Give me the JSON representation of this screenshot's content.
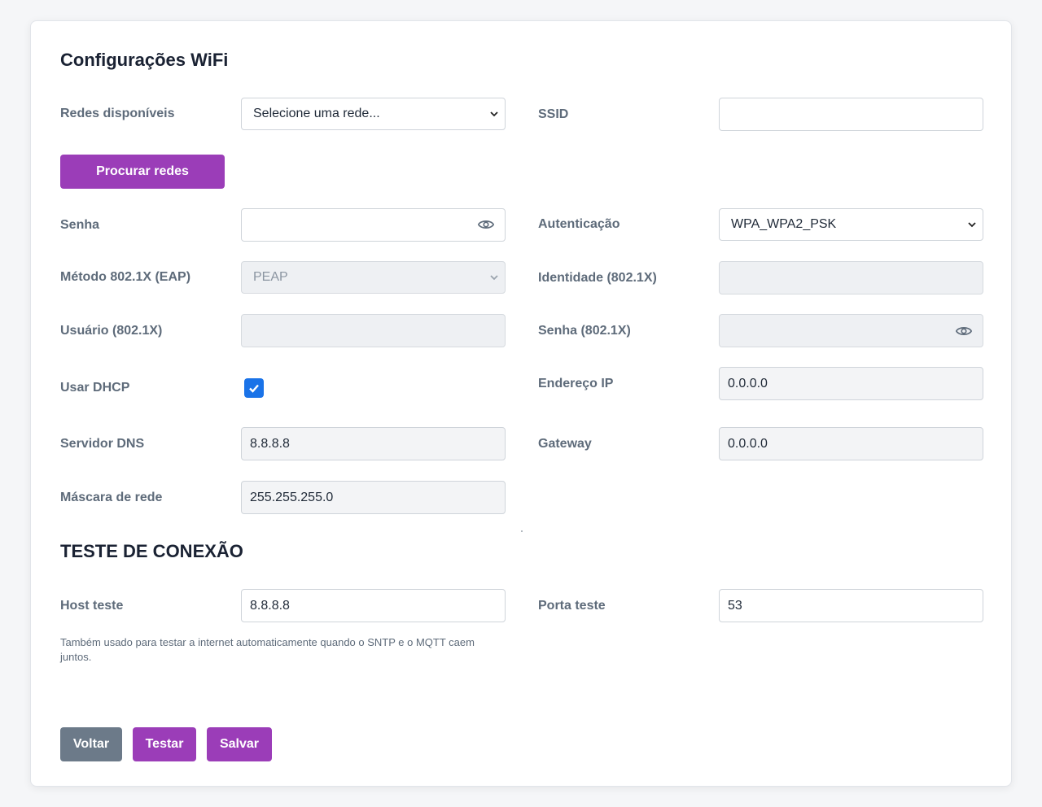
{
  "page": {
    "title": "Configurações WiFi",
    "section_test_title": "TESTE DE CONEXÃO"
  },
  "networks": {
    "label": "Redes disponíveis",
    "select_value": "Selecione uma rede...",
    "scan_button": "Procurar redes"
  },
  "ssid": {
    "label": "SSID",
    "value": ""
  },
  "password": {
    "label": "Senha",
    "value": ""
  },
  "auth": {
    "label": "Autenticação",
    "value": "WPA_WPA2_PSK"
  },
  "eap_method": {
    "label": "Método 802.1X (EAP)",
    "value": "PEAP"
  },
  "identity": {
    "label": "Identidade (802.1X)",
    "value": ""
  },
  "username": {
    "label": "Usuário (802.1X)",
    "value": ""
  },
  "eap_password": {
    "label": "Senha (802.1X)",
    "value": ""
  },
  "dhcp": {
    "label": "Usar DHCP",
    "checked": true
  },
  "ip": {
    "label": "Endereço IP",
    "value": "0.0.0.0"
  },
  "dns": {
    "label": "Servidor DNS",
    "value": "8.8.8.8"
  },
  "gateway": {
    "label": "Gateway",
    "value": "0.0.0.0"
  },
  "netmask": {
    "label": "Máscara de rede",
    "value": "255.255.255.0"
  },
  "test": {
    "host_label": "Host teste",
    "host_value": "8.8.8.8",
    "port_label": "Porta teste",
    "port_value": "53",
    "hint": "Também usado para testar a internet automaticamente quando o SNTP e o MQTT caem juntos."
  },
  "actions": {
    "back": "Voltar",
    "test": "Testar",
    "save": "Salvar"
  },
  "colors": {
    "accent": "#9b3db8",
    "secondary_button": "#6c7a89",
    "checkbox": "#1a73e8"
  }
}
